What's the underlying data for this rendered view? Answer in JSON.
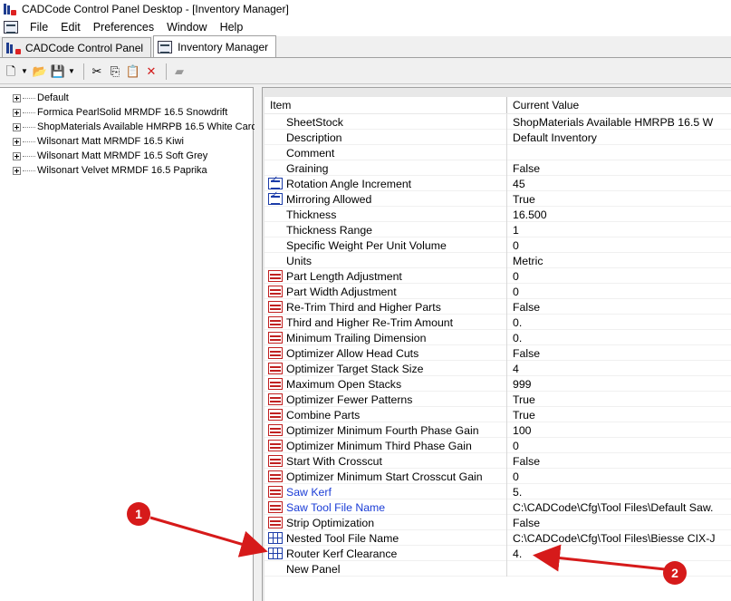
{
  "window": {
    "title": "CADCode Control Panel Desktop - [Inventory Manager]"
  },
  "menu": [
    "File",
    "Edit",
    "Preferences",
    "Window",
    "Help"
  ],
  "tabs": [
    {
      "label": "CADCode Control Panel",
      "icon": "cadcode-icon",
      "active": false
    },
    {
      "label": "Inventory Manager",
      "icon": "inventory-icon",
      "active": true
    }
  ],
  "toolbar": {
    "buttons": [
      "new-file-icon",
      "open-folder-icon",
      "save-icon",
      "cut-icon",
      "copy-icon",
      "paste-icon",
      "delete-icon",
      "properties-icon"
    ]
  },
  "tree": {
    "items": [
      "Default",
      "Formica PearlSolid MRMDF 16.5 Snowdrift",
      "ShopMaterials Available HMRPB 16.5 White Carc",
      "Wilsonart Matt MRMDF 16.5 Kiwi",
      "Wilsonart Matt MRMDF 16.5 Soft Grey",
      "Wilsonart Velvet MRMDF 16.5 Paprika"
    ]
  },
  "grid": {
    "headers": {
      "item": "Item",
      "value": "Current Value"
    },
    "rows": [
      {
        "label": "SheetStock",
        "value": "ShopMaterials Available HMRPB 16.5 W",
        "icon": "none",
        "blue": false
      },
      {
        "label": "Description",
        "value": "Default Inventory",
        "icon": "none",
        "blue": false
      },
      {
        "label": "Comment",
        "value": "",
        "icon": "none",
        "blue": false
      },
      {
        "label": "Graining",
        "value": "False",
        "icon": "none",
        "blue": false
      },
      {
        "label": "Rotation Angle Increment",
        "value": "45",
        "icon": "checklist-icon",
        "blue": false
      },
      {
        "label": "Mirroring Allowed",
        "value": "True",
        "icon": "checklist-icon",
        "blue": false
      },
      {
        "label": "Thickness",
        "value": "16.500",
        "icon": "none",
        "blue": false
      },
      {
        "label": "Thickness Range",
        "value": "1",
        "icon": "none",
        "blue": false
      },
      {
        "label": "Specific Weight Per Unit Volume",
        "value": "0",
        "icon": "none",
        "blue": false
      },
      {
        "label": "Units",
        "value": "Metric",
        "icon": "none",
        "blue": false
      },
      {
        "label": "Part Length Adjustment",
        "value": "0",
        "icon": "saw-panel-icon",
        "blue": false
      },
      {
        "label": "Part Width Adjustment",
        "value": "0",
        "icon": "saw-panel-icon",
        "blue": false
      },
      {
        "label": "Re-Trim Third and Higher Parts",
        "value": "False",
        "icon": "saw-panel-icon",
        "blue": false
      },
      {
        "label": "Third and Higher Re-Trim Amount",
        "value": "0.",
        "icon": "saw-panel-icon",
        "blue": false
      },
      {
        "label": "Minimum Trailing Dimension",
        "value": "0.",
        "icon": "saw-panel-icon",
        "blue": false
      },
      {
        "label": "Optimizer Allow Head Cuts",
        "value": "False",
        "icon": "saw-panel-icon",
        "blue": false
      },
      {
        "label": "Optimizer Target Stack Size",
        "value": "4",
        "icon": "saw-panel-icon",
        "blue": false
      },
      {
        "label": "Maximum Open Stacks",
        "value": "999",
        "icon": "saw-panel-icon",
        "blue": false
      },
      {
        "label": "Optimizer Fewer Patterns",
        "value": "True",
        "icon": "saw-panel-icon",
        "blue": false
      },
      {
        "label": "Combine Parts",
        "value": "True",
        "icon": "saw-panel-icon",
        "blue": false
      },
      {
        "label": "Optimizer Minimum Fourth Phase Gain",
        "value": "100",
        "icon": "saw-panel-icon",
        "blue": false
      },
      {
        "label": "Optimizer Minimum Third Phase Gain",
        "value": "0",
        "icon": "saw-panel-icon",
        "blue": false
      },
      {
        "label": "Start With Crosscut",
        "value": "False",
        "icon": "saw-panel-icon",
        "blue": false
      },
      {
        "label": "Optimizer Minimum Start Crosscut Gain",
        "value": "0",
        "icon": "saw-panel-icon",
        "blue": false
      },
      {
        "label": "Saw Kerf",
        "value": "5.",
        "icon": "saw-panel-icon",
        "blue": true
      },
      {
        "label": "Saw Tool File Name",
        "value": "C:\\CADCode\\Cfg\\Tool Files\\Default Saw.",
        "icon": "saw-panel-icon",
        "blue": true
      },
      {
        "label": "Strip Optimization",
        "value": "False",
        "icon": "saw-panel-icon",
        "blue": false
      },
      {
        "label": "Nested Tool File Name",
        "value": "C:\\CADCode\\Cfg\\Tool Files\\Biesse CIX-J",
        "icon": "nesting-grid-icon",
        "blue": false
      },
      {
        "label": "Router Kerf Clearance",
        "value": "4.",
        "icon": "nesting-grid-icon",
        "blue": false
      },
      {
        "label": "New Panel",
        "value": "",
        "icon": "none",
        "blue": false
      }
    ]
  },
  "annotations": [
    {
      "label": "1",
      "color": "#d61a1a"
    },
    {
      "label": "2",
      "color": "#d61a1a"
    }
  ]
}
